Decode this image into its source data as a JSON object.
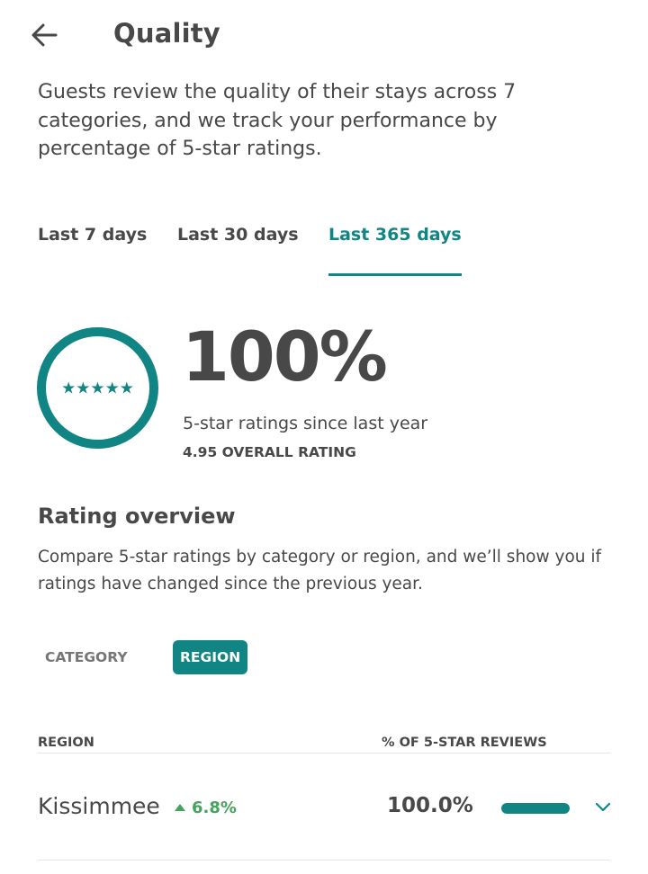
{
  "header": {
    "back_icon": "arrow-left-icon",
    "title": "Quality"
  },
  "intro": "Guests review the quality of their stays across 7 categories, and we track your performance by percentage of 5-star ratings.",
  "tabs": [
    {
      "label": "Last 7 days",
      "selected": false
    },
    {
      "label": "Last 30 days",
      "selected": false
    },
    {
      "label": "Last 365 days",
      "selected": true
    }
  ],
  "score": {
    "badge_stars": "★★★★★",
    "percent": "100%",
    "caption": "5-star ratings since last year",
    "overall": "4.95 OVERALL RATING"
  },
  "overview": {
    "title": "Rating overview",
    "description": "Compare 5-star ratings by category or region, and we’ll show you if ratings have changed since the previous year.",
    "toggle": [
      {
        "label": "CATEGORY",
        "selected": false
      },
      {
        "label": "REGION",
        "selected": true
      }
    ]
  },
  "table": {
    "headers": [
      "REGION",
      "% OF 5-STAR REVIEWS"
    ],
    "rows": [
      {
        "name": "Kissimmee",
        "change": "6.8%",
        "change_direction": "up",
        "percent": "100.0%",
        "bar_fraction": 1.0,
        "expand_icon": "chevron-down-icon"
      }
    ]
  },
  "colors": {
    "accent": "#118484",
    "positive": "#46a35e",
    "text": "#484848",
    "muted": "#767676"
  }
}
